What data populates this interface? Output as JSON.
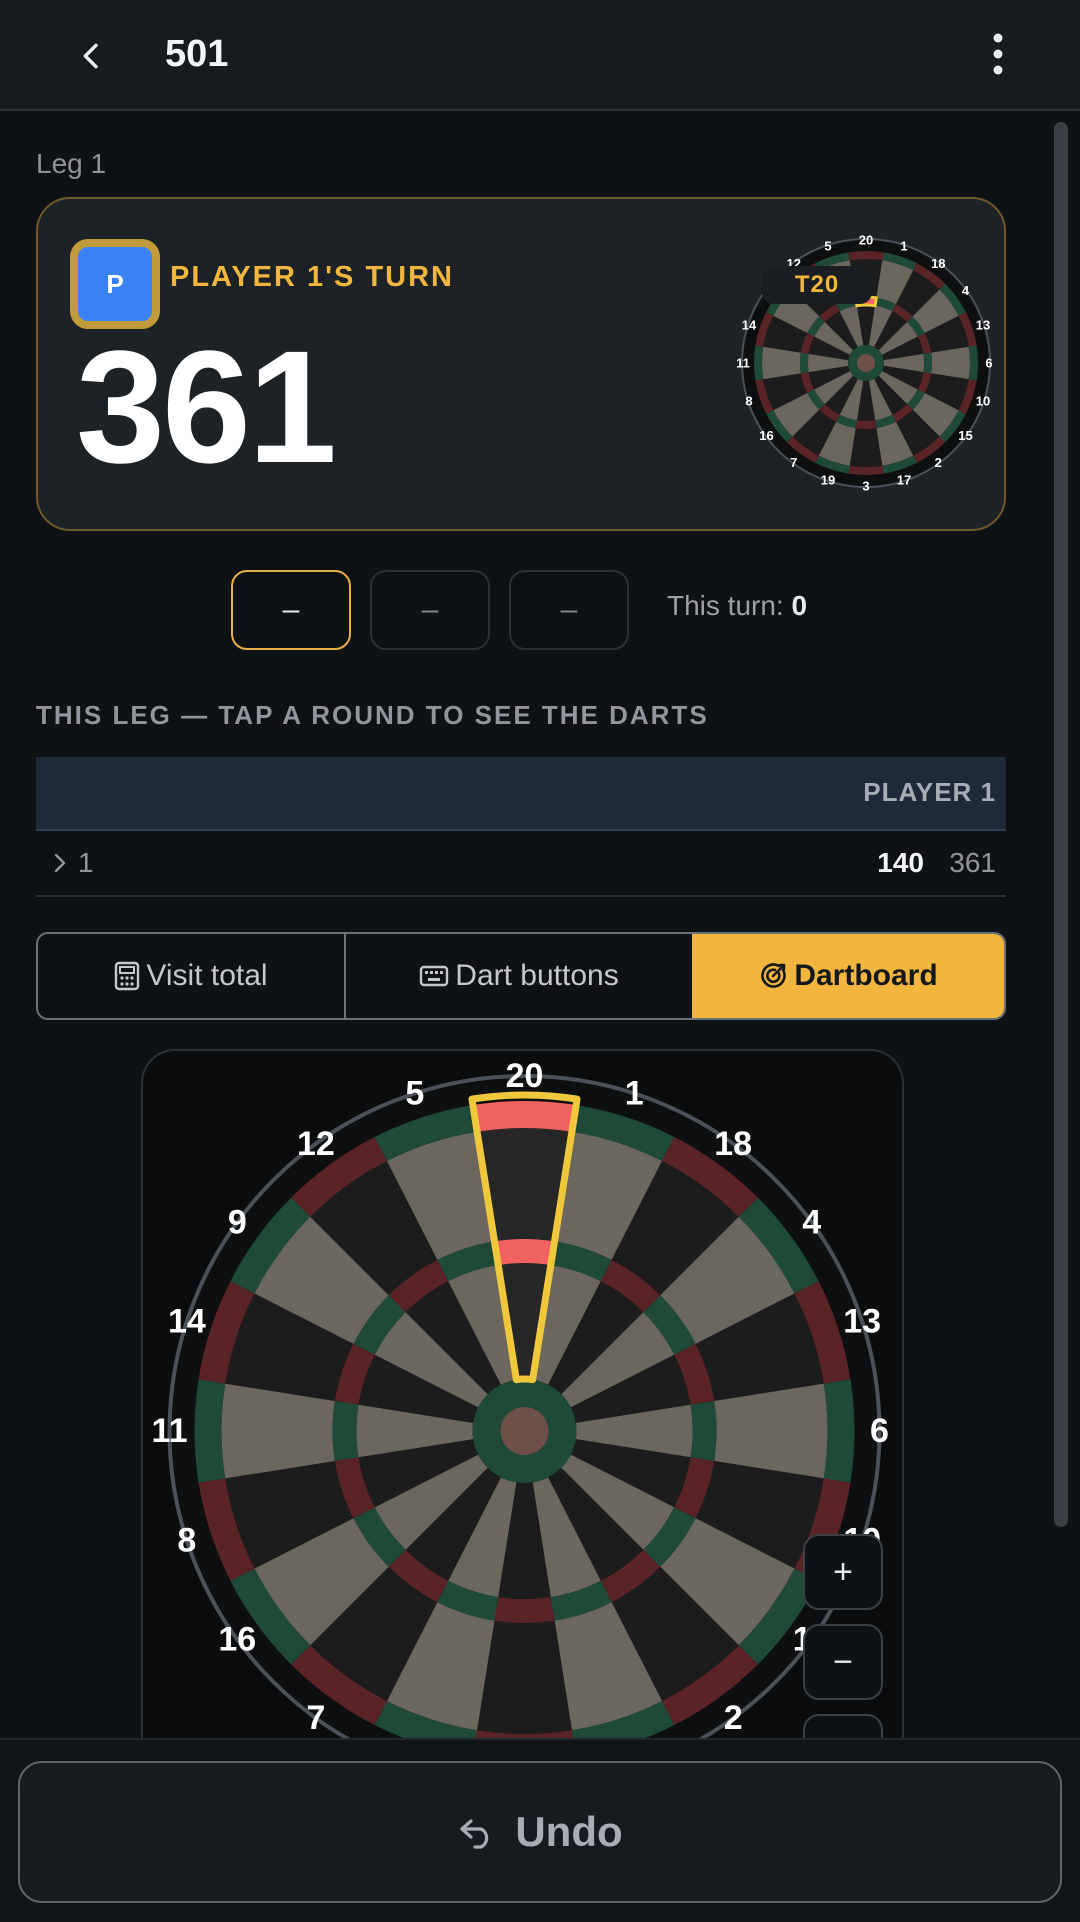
{
  "header": {
    "title": "501",
    "back_icon": "chevron-left-icon",
    "menu_icon": "more-vertical-icon"
  },
  "leg": {
    "label": "Leg 1"
  },
  "turn": {
    "player_initial": "P",
    "label": "PLAYER 1'S TURN",
    "remaining": "361",
    "target": "T20"
  },
  "darts": {
    "slots": [
      "–",
      "–",
      "–"
    ],
    "this_turn_label": "This turn:",
    "this_turn_value": "0"
  },
  "rounds": {
    "heading": "THIS LEG — TAP A ROUND TO SEE THE DARTS",
    "column": "PLAYER 1",
    "rows": [
      {
        "round": "1",
        "score": "140",
        "remaining": "361"
      }
    ]
  },
  "input_modes": {
    "options": [
      "Visit total",
      "Dart buttons",
      "Dartboard"
    ],
    "selected": "Dartboard"
  },
  "dartboard": {
    "numbers": [
      "20",
      "1",
      "18",
      "4",
      "13",
      "6",
      "10",
      "15",
      "2",
      "17",
      "3",
      "19",
      "7",
      "16",
      "8",
      "11",
      "14",
      "9",
      "12",
      "5"
    ],
    "highlighted_segment": "20"
  },
  "zoom": {
    "in_label": "+",
    "out_label": "−"
  },
  "footer": {
    "undo_label": "Undo"
  },
  "colors": {
    "accent": "#f2b63e",
    "avatar": "#3b82f6",
    "board_green": "#1f4a38",
    "board_red": "#5a2326",
    "board_light": "#6b675f",
    "board_dark": "#1c1c1c",
    "highlight": "#f0c83c"
  }
}
